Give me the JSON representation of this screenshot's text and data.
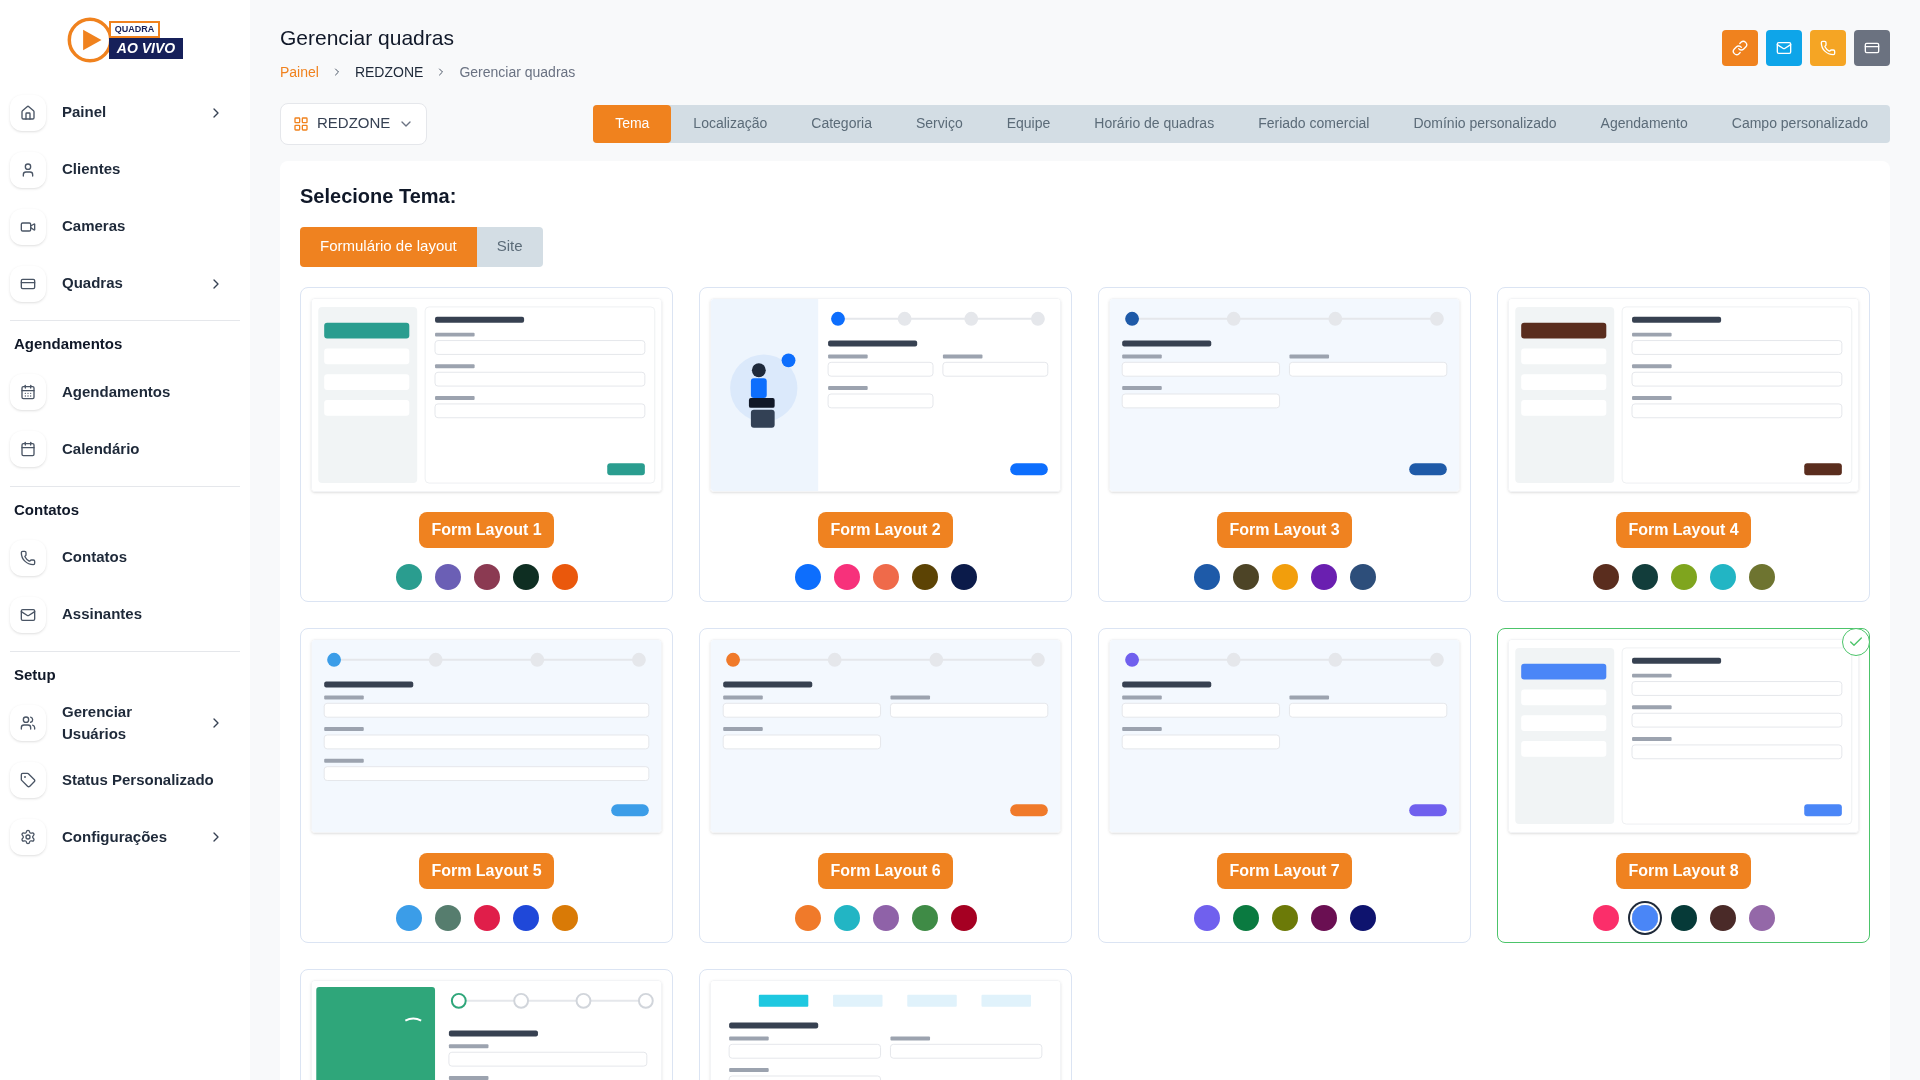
{
  "logo": {
    "line1": "QUADRA",
    "line2": "AO VIVO"
  },
  "sidebar": {
    "sections": [
      {
        "items": [
          {
            "label": "Painel",
            "has_submenu": true
          },
          {
            "label": "Clientes",
            "has_submenu": false
          },
          {
            "label": "Cameras",
            "has_submenu": false
          },
          {
            "label": "Quadras",
            "has_submenu": true
          }
        ]
      },
      {
        "heading": "Agendamentos",
        "items": [
          {
            "label": "Agendamentos",
            "has_submenu": false
          },
          {
            "label": "Calendário",
            "has_submenu": false
          }
        ]
      },
      {
        "heading": "Contatos",
        "items": [
          {
            "label": "Contatos",
            "has_submenu": false
          },
          {
            "label": "Assinantes",
            "has_submenu": false
          }
        ]
      },
      {
        "heading": "Setup",
        "items": [
          {
            "label": "Gerenciar Usuários",
            "has_submenu": true
          },
          {
            "label": "Status Personalizado",
            "has_submenu": false
          },
          {
            "label": "Configurações",
            "has_submenu": true
          }
        ]
      }
    ]
  },
  "header": {
    "title": "Gerenciar quadras",
    "breadcrumb": [
      "Painel",
      "REDZONE",
      "Gerenciar quadras"
    ],
    "actions": [
      {
        "color": "#f0821e"
      },
      {
        "color": "#0ea5e9"
      },
      {
        "color": "#f5a524"
      },
      {
        "color": "#6b7280"
      }
    ]
  },
  "venue_select": {
    "value": "REDZONE"
  },
  "tabs": [
    {
      "label": "Tema",
      "selected": true
    },
    {
      "label": "Localização",
      "selected": false
    },
    {
      "label": "Categoria",
      "selected": false
    },
    {
      "label": "Serviço",
      "selected": false
    },
    {
      "label": "Equipe",
      "selected": false
    },
    {
      "label": "Horário de quadras",
      "selected": false
    },
    {
      "label": "Feriado comercial",
      "selected": false
    },
    {
      "label": "Domínio personalizado",
      "selected": false
    },
    {
      "label": "Agendamento",
      "selected": false
    },
    {
      "label": "Campo personalizado",
      "selected": false
    }
  ],
  "theme": {
    "title": "Selecione Tema:",
    "modes": [
      {
        "label": "Formulário de layout",
        "selected": true
      },
      {
        "label": "Site",
        "selected": false
      }
    ],
    "layouts": [
      {
        "name": "Form Layout 1",
        "selected": false,
        "preview": {
          "kind": "sidebar",
          "color": "#2a9d8f"
        },
        "swatches": [
          {
            "color": "#2a9d8f",
            "selected": false
          },
          {
            "color": "#6b5fb5",
            "selected": false
          },
          {
            "color": "#8b3a52",
            "selected": false
          },
          {
            "color": "#0e2e22",
            "selected": false
          },
          {
            "color": "#ea580c",
            "selected": false
          }
        ]
      },
      {
        "name": "Form Layout 2",
        "selected": false,
        "preview": {
          "kind": "top",
          "color": "#0d6efd",
          "illustration": true
        },
        "swatches": [
          {
            "color": "#0d6efd",
            "selected": false
          },
          {
            "color": "#f7317b",
            "selected": false
          },
          {
            "color": "#ef6a4a",
            "selected": false
          },
          {
            "color": "#5c4304",
            "selected": false
          },
          {
            "color": "#0b1b4a",
            "selected": false
          }
        ]
      },
      {
        "name": "Form Layout 3",
        "selected": false,
        "preview": {
          "kind": "top",
          "color": "#1e5aa8",
          "illustration": false
        },
        "swatches": [
          {
            "color": "#1e5aa8",
            "selected": false
          },
          {
            "color": "#4d4426",
            "selected": false
          },
          {
            "color": "#f29e0c",
            "selected": false
          },
          {
            "color": "#6a1fb0",
            "selected": false
          },
          {
            "color": "#2d4e7a",
            "selected": false
          }
        ]
      },
      {
        "name": "Form Layout 4",
        "selected": false,
        "preview": {
          "kind": "sidebar",
          "color": "#5a2d1e"
        },
        "swatches": [
          {
            "color": "#5a2d1e",
            "selected": false
          },
          {
            "color": "#123d3b",
            "selected": false
          },
          {
            "color": "#7fa51e",
            "selected": false
          },
          {
            "color": "#22b5c4",
            "selected": false
          },
          {
            "color": "#6e7430",
            "selected": false
          }
        ]
      },
      {
        "name": "Form Layout 5",
        "selected": false,
        "preview": {
          "kind": "top",
          "color": "#3b9de8",
          "illustration": false,
          "single_column": true
        },
        "swatches": [
          {
            "color": "#3b9de8",
            "selected": false
          },
          {
            "color": "#567d6e",
            "selected": false
          },
          {
            "color": "#e01e4a",
            "selected": false
          },
          {
            "color": "#1f48d9",
            "selected": false
          },
          {
            "color": "#d97a06",
            "selected": false
          }
        ]
      },
      {
        "name": "Form Layout 6",
        "selected": false,
        "preview": {
          "kind": "top",
          "color": "#f07a2a",
          "illustration": false
        },
        "swatches": [
          {
            "color": "#f07a2a",
            "selected": false
          },
          {
            "color": "#22b5c4",
            "selected": false
          },
          {
            "color": "#8f62a8",
            "selected": false
          },
          {
            "color": "#3f8b46",
            "selected": false
          },
          {
            "color": "#a50022",
            "selected": false
          }
        ]
      },
      {
        "name": "Form Layout 7",
        "selected": false,
        "preview": {
          "kind": "top",
          "color": "#7060ee",
          "illustration": false
        },
        "swatches": [
          {
            "color": "#7060ee",
            "selected": false
          },
          {
            "color": "#0a7a40",
            "selected": false
          },
          {
            "color": "#6c7a08",
            "selected": false
          },
          {
            "color": "#6a0f52",
            "selected": false
          },
          {
            "color": "#0e136e",
            "selected": false
          }
        ]
      },
      {
        "name": "Form Layout 8",
        "selected": true,
        "preview": {
          "kind": "sidebar",
          "color": "#4a86f7"
        },
        "swatches": [
          {
            "color": "#fb2e6a",
            "selected": false
          },
          {
            "color": "#4a86f7",
            "selected": true
          },
          {
            "color": "#063a38",
            "selected": false
          },
          {
            "color": "#4a2a28",
            "selected": false
          },
          {
            "color": "#9468a8",
            "selected": false
          }
        ]
      },
      {
        "selected": false,
        "preview": {
          "kind": "banner",
          "color": "#2fa67a"
        }
      },
      {
        "selected": false,
        "preview": {
          "kind": "boxes",
          "color": "#1ec8e0"
        }
      }
    ]
  }
}
